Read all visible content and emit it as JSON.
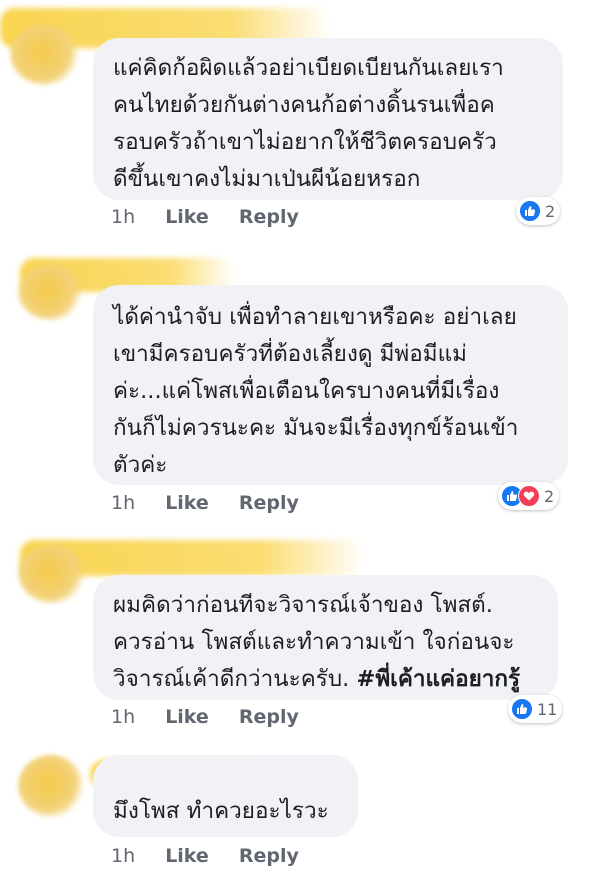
{
  "comments": [
    {
      "lines": [
        "แค่คิดก้อผิดแล้วอย่าเบียดเบียนกันเลยเรา",
        "คนไทยด้วยกันต่างคนก้อต่างดิ้นรนเพื่อค",
        "รอบครัวถ้าเขาไม่อยากให้ชีวิตครอบครัว",
        "ดีขึ้นเขาคงไม่มาเป่นผีน้อยหรอก"
      ],
      "time": "1h",
      "like": "Like",
      "reply": "Reply",
      "reaction_count": "2",
      "reactions": [
        "like"
      ]
    },
    {
      "lines": [
        "ได้ค่านำจับ เพื่อทำลายเขาหรือคะ อย่าเลย",
        "เขามีครอบครัวที่ต้องเลี้ยงดู มีพ่อมีแม่",
        "ค่ะ...แค่โพสเพื่อเตือนใครบางคนที่มีเรื่อง",
        "กันก็ไม่ควรนะคะ มันจะมีเรื่องทุกข์ร้อนเข้า",
        "ตัวค่ะ"
      ],
      "time": "1h",
      "like": "Like",
      "reply": "Reply",
      "reaction_count": "2",
      "reactions": [
        "like",
        "love"
      ]
    },
    {
      "lines": [
        "ผมคิดว่าก่อนทีจะวิจารณ์เจ้าของ โพสต์.",
        "ควรอ่าน โพสต์และทำความเข้า ใจก่อนจะ",
        "วิจารณ์เค้าดีกว่านะครับ."
      ],
      "hashtag": "#พี่เค้าแค่อยากรู้",
      "time": "1h",
      "like": "Like",
      "reply": "Reply",
      "reaction_count": "11",
      "reactions": [
        "like"
      ]
    },
    {
      "lines": [
        "มึงโพส ทำควยอะไรวะ"
      ],
      "time": "1h",
      "like": "Like",
      "reply": "Reply"
    }
  ]
}
